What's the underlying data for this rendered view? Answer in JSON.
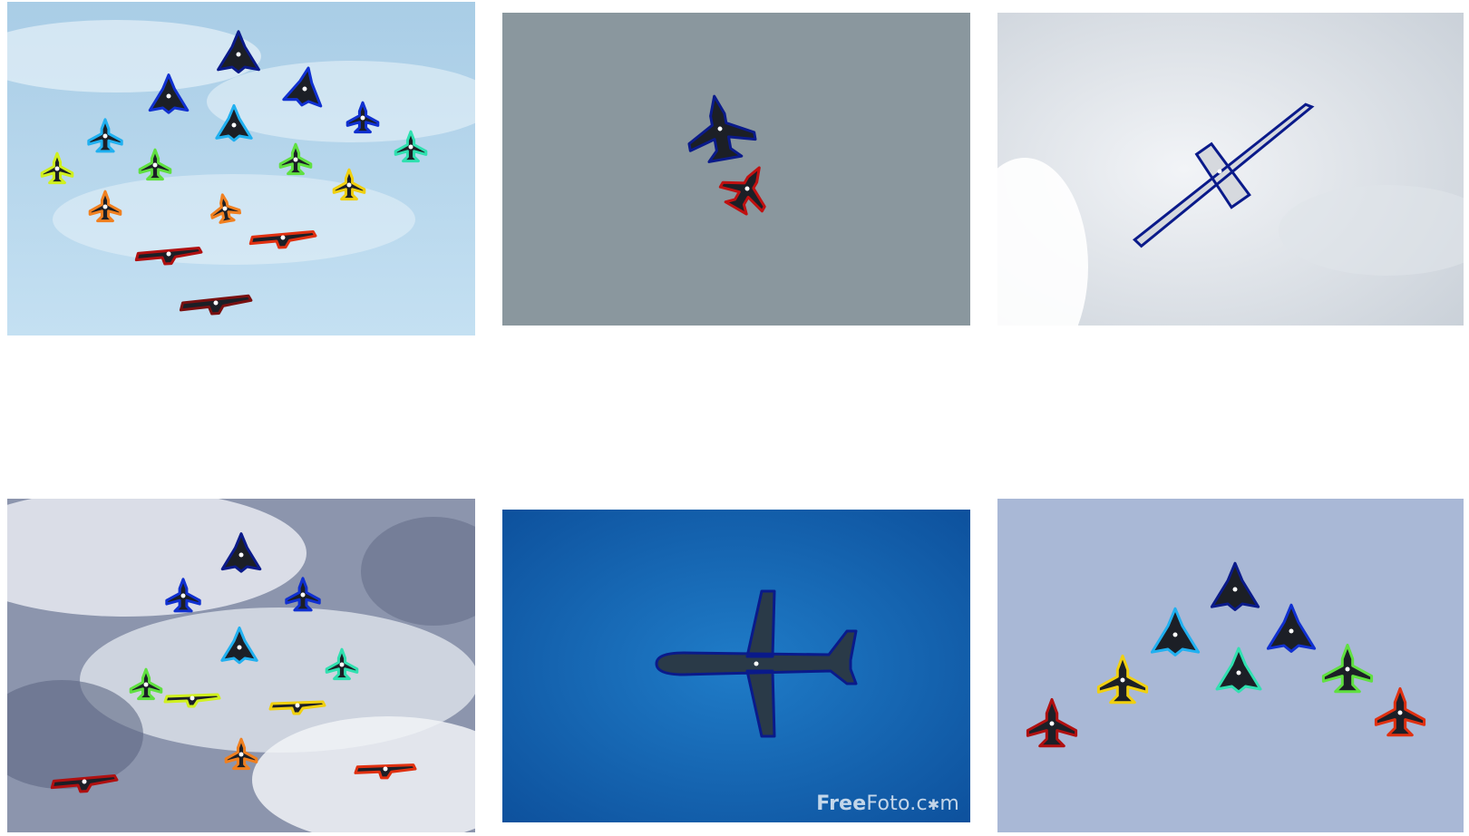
{
  "image_description_free": true,
  "panels": [
    {
      "id": "p1",
      "sky": "light-blue-cloudy",
      "outline_palette": [
        "#0a1a8a",
        "#1030d0",
        "#20b0f0",
        "#30e0b0",
        "#60e040",
        "#d0f020",
        "#f0d010",
        "#f08020",
        "#e03010",
        "#b01010",
        "#7a1010"
      ]
    },
    {
      "id": "p2",
      "sky": "grey",
      "outline_palette": [
        "#0a1a8a",
        "#c01010"
      ]
    },
    {
      "id": "p3",
      "sky": "white-cloudy",
      "outline_palette": [
        "#0a1a8a"
      ]
    },
    {
      "id": "p4",
      "sky": "grey-blue-cloudy",
      "outline_palette": [
        "#0a1a8a",
        "#1030d0",
        "#20b0f0",
        "#30e0b0",
        "#60e040",
        "#d0f020",
        "#f0d010",
        "#f08020",
        "#e03010",
        "#b01010"
      ]
    },
    {
      "id": "p5",
      "sky": "deep-blue",
      "outline_palette": [
        "#0a1a8a"
      ],
      "watermark": {
        "free": "Free",
        "foto": "Foto.c",
        "star": "✱",
        "m": "m"
      }
    },
    {
      "id": "p6",
      "sky": "pale-blue",
      "outline_palette": [
        "#0a1a8a",
        "#1030d0",
        "#20b0f0",
        "#30e0b0",
        "#60e040",
        "#f0d010",
        "#e03010",
        "#b01010"
      ]
    }
  ]
}
